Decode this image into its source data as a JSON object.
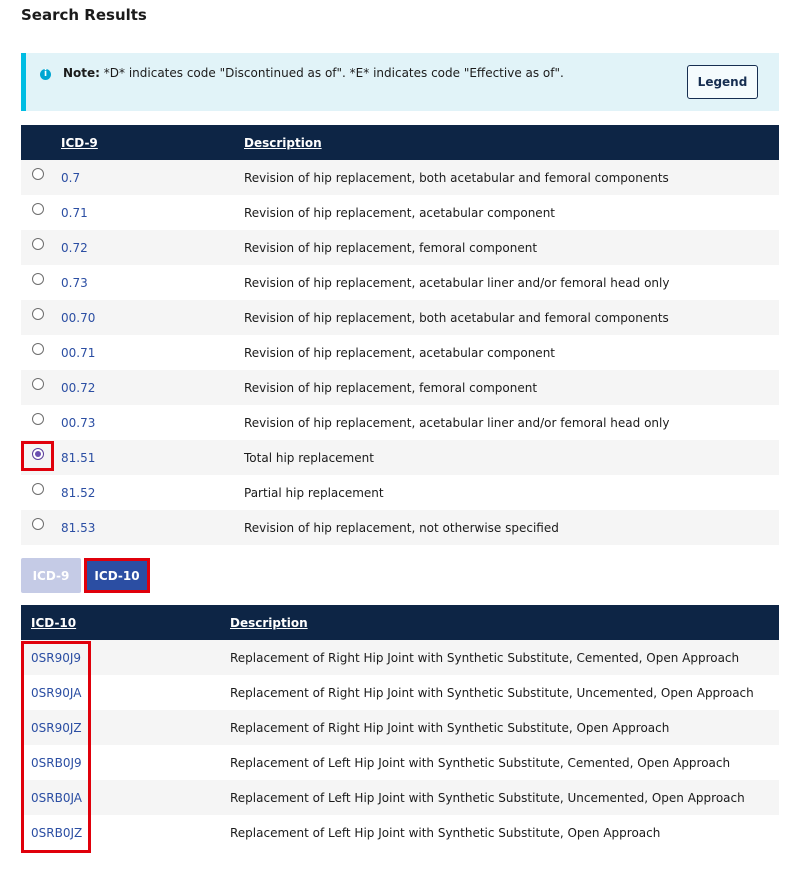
{
  "page": {
    "title": "Search Results"
  },
  "note": {
    "label": "Note:",
    "text": " *D* indicates code \"Discontinued as of\". *E* indicates code \"Effective as of\".",
    "legend_label": "Legend"
  },
  "icd9_table": {
    "headers": {
      "code": "ICD-9",
      "description": "Description"
    },
    "rows": [
      {
        "code": "0.7",
        "description": "Revision of hip replacement, both acetabular and femoral components",
        "selected": false
      },
      {
        "code": "0.71",
        "description": "Revision of hip replacement, acetabular component",
        "selected": false
      },
      {
        "code": "0.72",
        "description": "Revision of hip replacement, femoral component",
        "selected": false
      },
      {
        "code": "0.73",
        "description": "Revision of hip replacement, acetabular liner and/or femoral head only",
        "selected": false
      },
      {
        "code": "00.70",
        "description": "Revision of hip replacement, both acetabular and femoral components",
        "selected": false
      },
      {
        "code": "00.71",
        "description": "Revision of hip replacement, acetabular component",
        "selected": false
      },
      {
        "code": "00.72",
        "description": "Revision of hip replacement, femoral component",
        "selected": false
      },
      {
        "code": "00.73",
        "description": "Revision of hip replacement, acetabular liner and/or femoral head only",
        "selected": false
      },
      {
        "code": "81.51",
        "description": "Total hip replacement",
        "selected": true
      },
      {
        "code": "81.52",
        "description": "Partial hip replacement",
        "selected": false
      },
      {
        "code": "81.53",
        "description": "Revision of hip replacement, not otherwise specified",
        "selected": false
      }
    ]
  },
  "tabs": {
    "icd9": "ICD-9",
    "icd10": "ICD-10",
    "active": "ICD-10"
  },
  "icd10_table": {
    "headers": {
      "code": "ICD-10",
      "description": "Description"
    },
    "rows": [
      {
        "code": "0SR90J9",
        "description": "Replacement of Right Hip Joint with Synthetic Substitute, Cemented, Open Approach"
      },
      {
        "code": "0SR90JA",
        "description": "Replacement of Right Hip Joint with Synthetic Substitute, Uncemented, Open Approach"
      },
      {
        "code": "0SR90JZ",
        "description": "Replacement of Right Hip Joint with Synthetic Substitute, Open Approach"
      },
      {
        "code": "0SRB0J9",
        "description": "Replacement of Left Hip Joint with Synthetic Substitute, Cemented, Open Approach"
      },
      {
        "code": "0SRB0JA",
        "description": "Replacement of Left Hip Joint with Synthetic Substitute, Uncemented, Open Approach"
      },
      {
        "code": "0SRB0JZ",
        "description": "Replacement of Left Hip Joint with Synthetic Substitute, Open Approach"
      }
    ]
  },
  "colors": {
    "header_bg": "#0d2545",
    "link": "#2b4ea3",
    "highlight": "#e0000b",
    "note_bg": "#e1f3f8"
  }
}
